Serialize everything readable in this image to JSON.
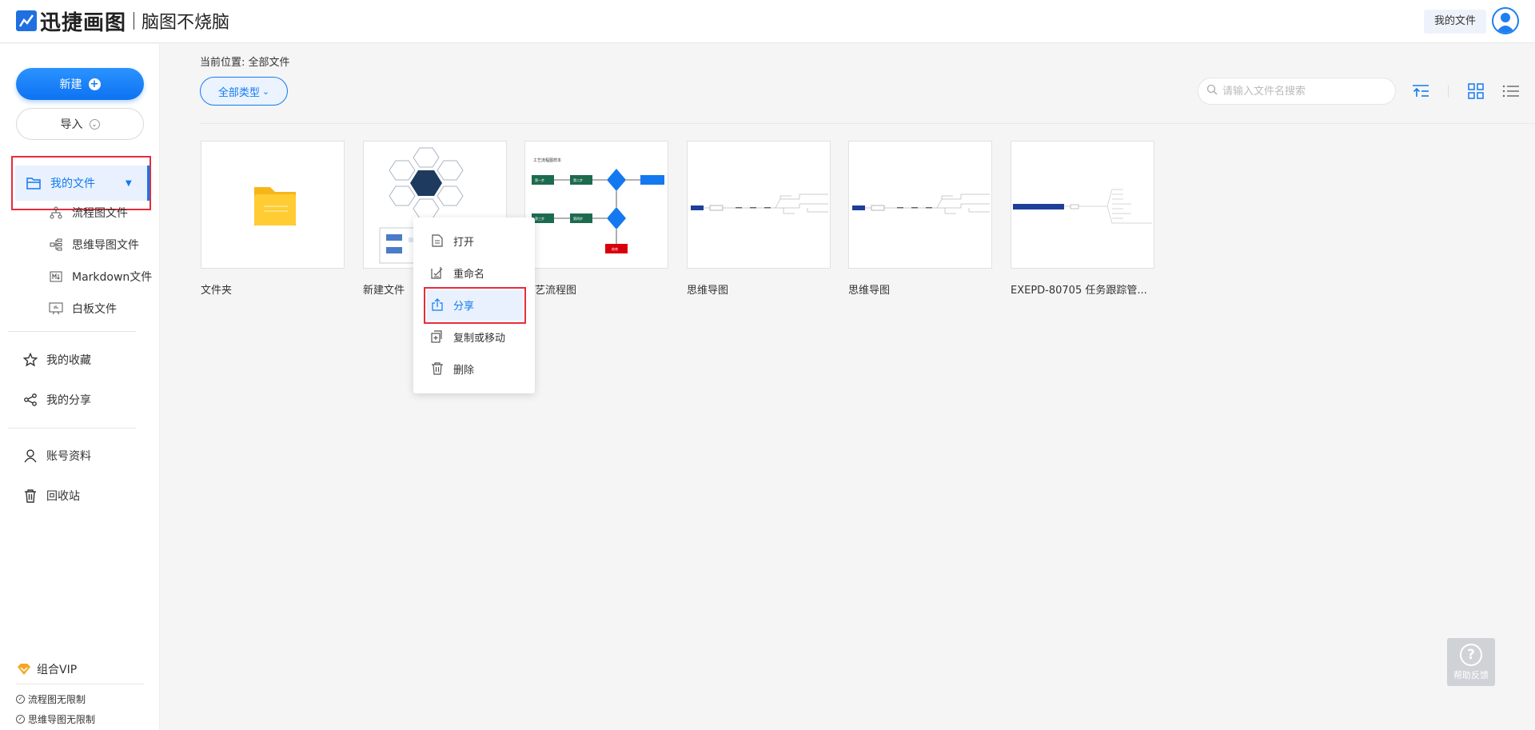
{
  "header": {
    "app_name": "迅捷画图",
    "slogan": "脑图不烧脑",
    "my_files_button": "我的文件"
  },
  "sidebar": {
    "new_button": "新建",
    "import_button": "导入",
    "my_files": "我的文件",
    "sub_items": [
      {
        "label": "流程图文件",
        "icon": "flowchart-icon"
      },
      {
        "label": "思维导图文件",
        "icon": "mindmap-icon"
      },
      {
        "label": "Markdown文件",
        "icon": "markdown-icon"
      },
      {
        "label": "白板文件",
        "icon": "whiteboard-icon"
      }
    ],
    "favorites": "我的收藏",
    "shares": "我的分享",
    "account": "账号资料",
    "recycle": "回收站",
    "vip": {
      "title": "组合VIP",
      "features": [
        "流程图无限制",
        "思维导图无限制"
      ]
    }
  },
  "main": {
    "breadcrumb_label": "当前位置:",
    "breadcrumb_value": "全部文件",
    "filter_label": "全部类型",
    "search_placeholder": "请输入文件名搜索",
    "files": [
      {
        "name": "文件夹",
        "type": "folder"
      },
      {
        "name": "新建文件",
        "type": "mindmap-hex"
      },
      {
        "name": "工艺流程图",
        "type": "flowchart"
      },
      {
        "name": "思维导图",
        "type": "mindmap"
      },
      {
        "name": "思维导图",
        "type": "mindmap"
      },
      {
        "name": "EXEPD-80705 任务跟踪管...",
        "type": "mindmap"
      }
    ],
    "thumb_texts": {
      "flow_title": "工艺流程图样本",
      "flow_node_1": "第一步",
      "flow_node_2": "第二步",
      "flow_node_3": "第三步",
      "flow_node_4": "第四步",
      "flow_end": "结束"
    }
  },
  "context_menu": {
    "items": [
      {
        "label": "打开",
        "icon": "open-icon"
      },
      {
        "label": "重命名",
        "icon": "rename-icon"
      },
      {
        "label": "分享",
        "icon": "share-icon"
      },
      {
        "label": "复制或移动",
        "icon": "copy-move-icon"
      },
      {
        "label": "删除",
        "icon": "delete-icon"
      }
    ]
  },
  "help": {
    "label": "帮助反馈"
  },
  "colors": {
    "accent": "#1479f0",
    "highlight_border": "#e52d3c",
    "folder": "#ffc933"
  }
}
